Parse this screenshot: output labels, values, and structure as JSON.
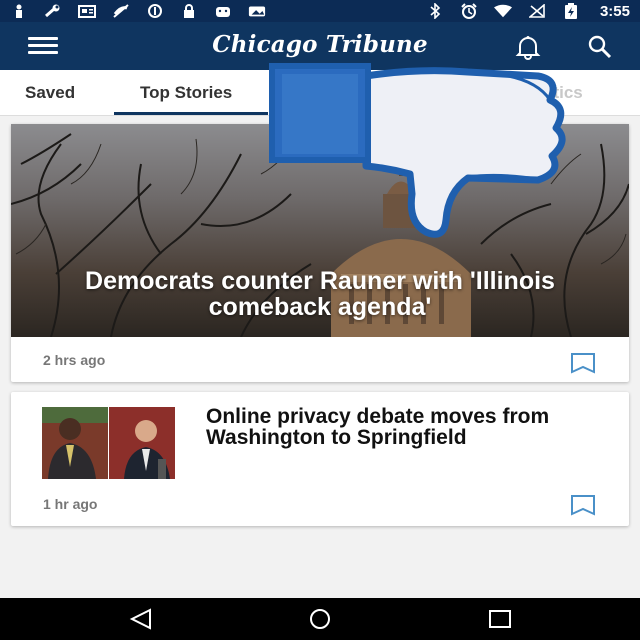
{
  "status_bar": {
    "time": "3:55",
    "left_icons": [
      "person-icon",
      "wrench-icon",
      "news-icon",
      "no-phone-icon",
      "sync-icon",
      "lock-icon",
      "android-icon",
      "photo-icon"
    ],
    "right_icons": [
      "bluetooth-icon",
      "alarm-icon",
      "wifi-icon",
      "no-signal-icon",
      "battery-charging-icon"
    ]
  },
  "app_bar": {
    "title": "Chicago Tribune",
    "menu_icon": "menu-icon",
    "notifications_icon": "bell-icon",
    "search_icon": "search-icon"
  },
  "tabs": [
    {
      "label": "Saved",
      "selected": false
    },
    {
      "label": "Top Stories",
      "selected": true
    },
    {
      "label": "litics",
      "selected": false
    }
  ],
  "stories": [
    {
      "headline": "Democrats counter Rauner with 'Illinois comeback agenda'",
      "time": "2 hrs ago",
      "bookmark_icon": "bookmark-icon"
    },
    {
      "headline": "Online privacy debate moves from Washington to Springfield",
      "time": "1 hr ago",
      "bookmark_icon": "bookmark-icon"
    }
  ],
  "overlay": {
    "icon": "thumbs-down-icon"
  },
  "nav_bar": {
    "icons": [
      "back-icon",
      "home-icon",
      "recents-icon"
    ]
  },
  "colors": {
    "brand": "#0f3560",
    "status_bar": "#0c2b55",
    "bookmark": "#4a90c8",
    "overlay_blue": "#1f5fae"
  }
}
